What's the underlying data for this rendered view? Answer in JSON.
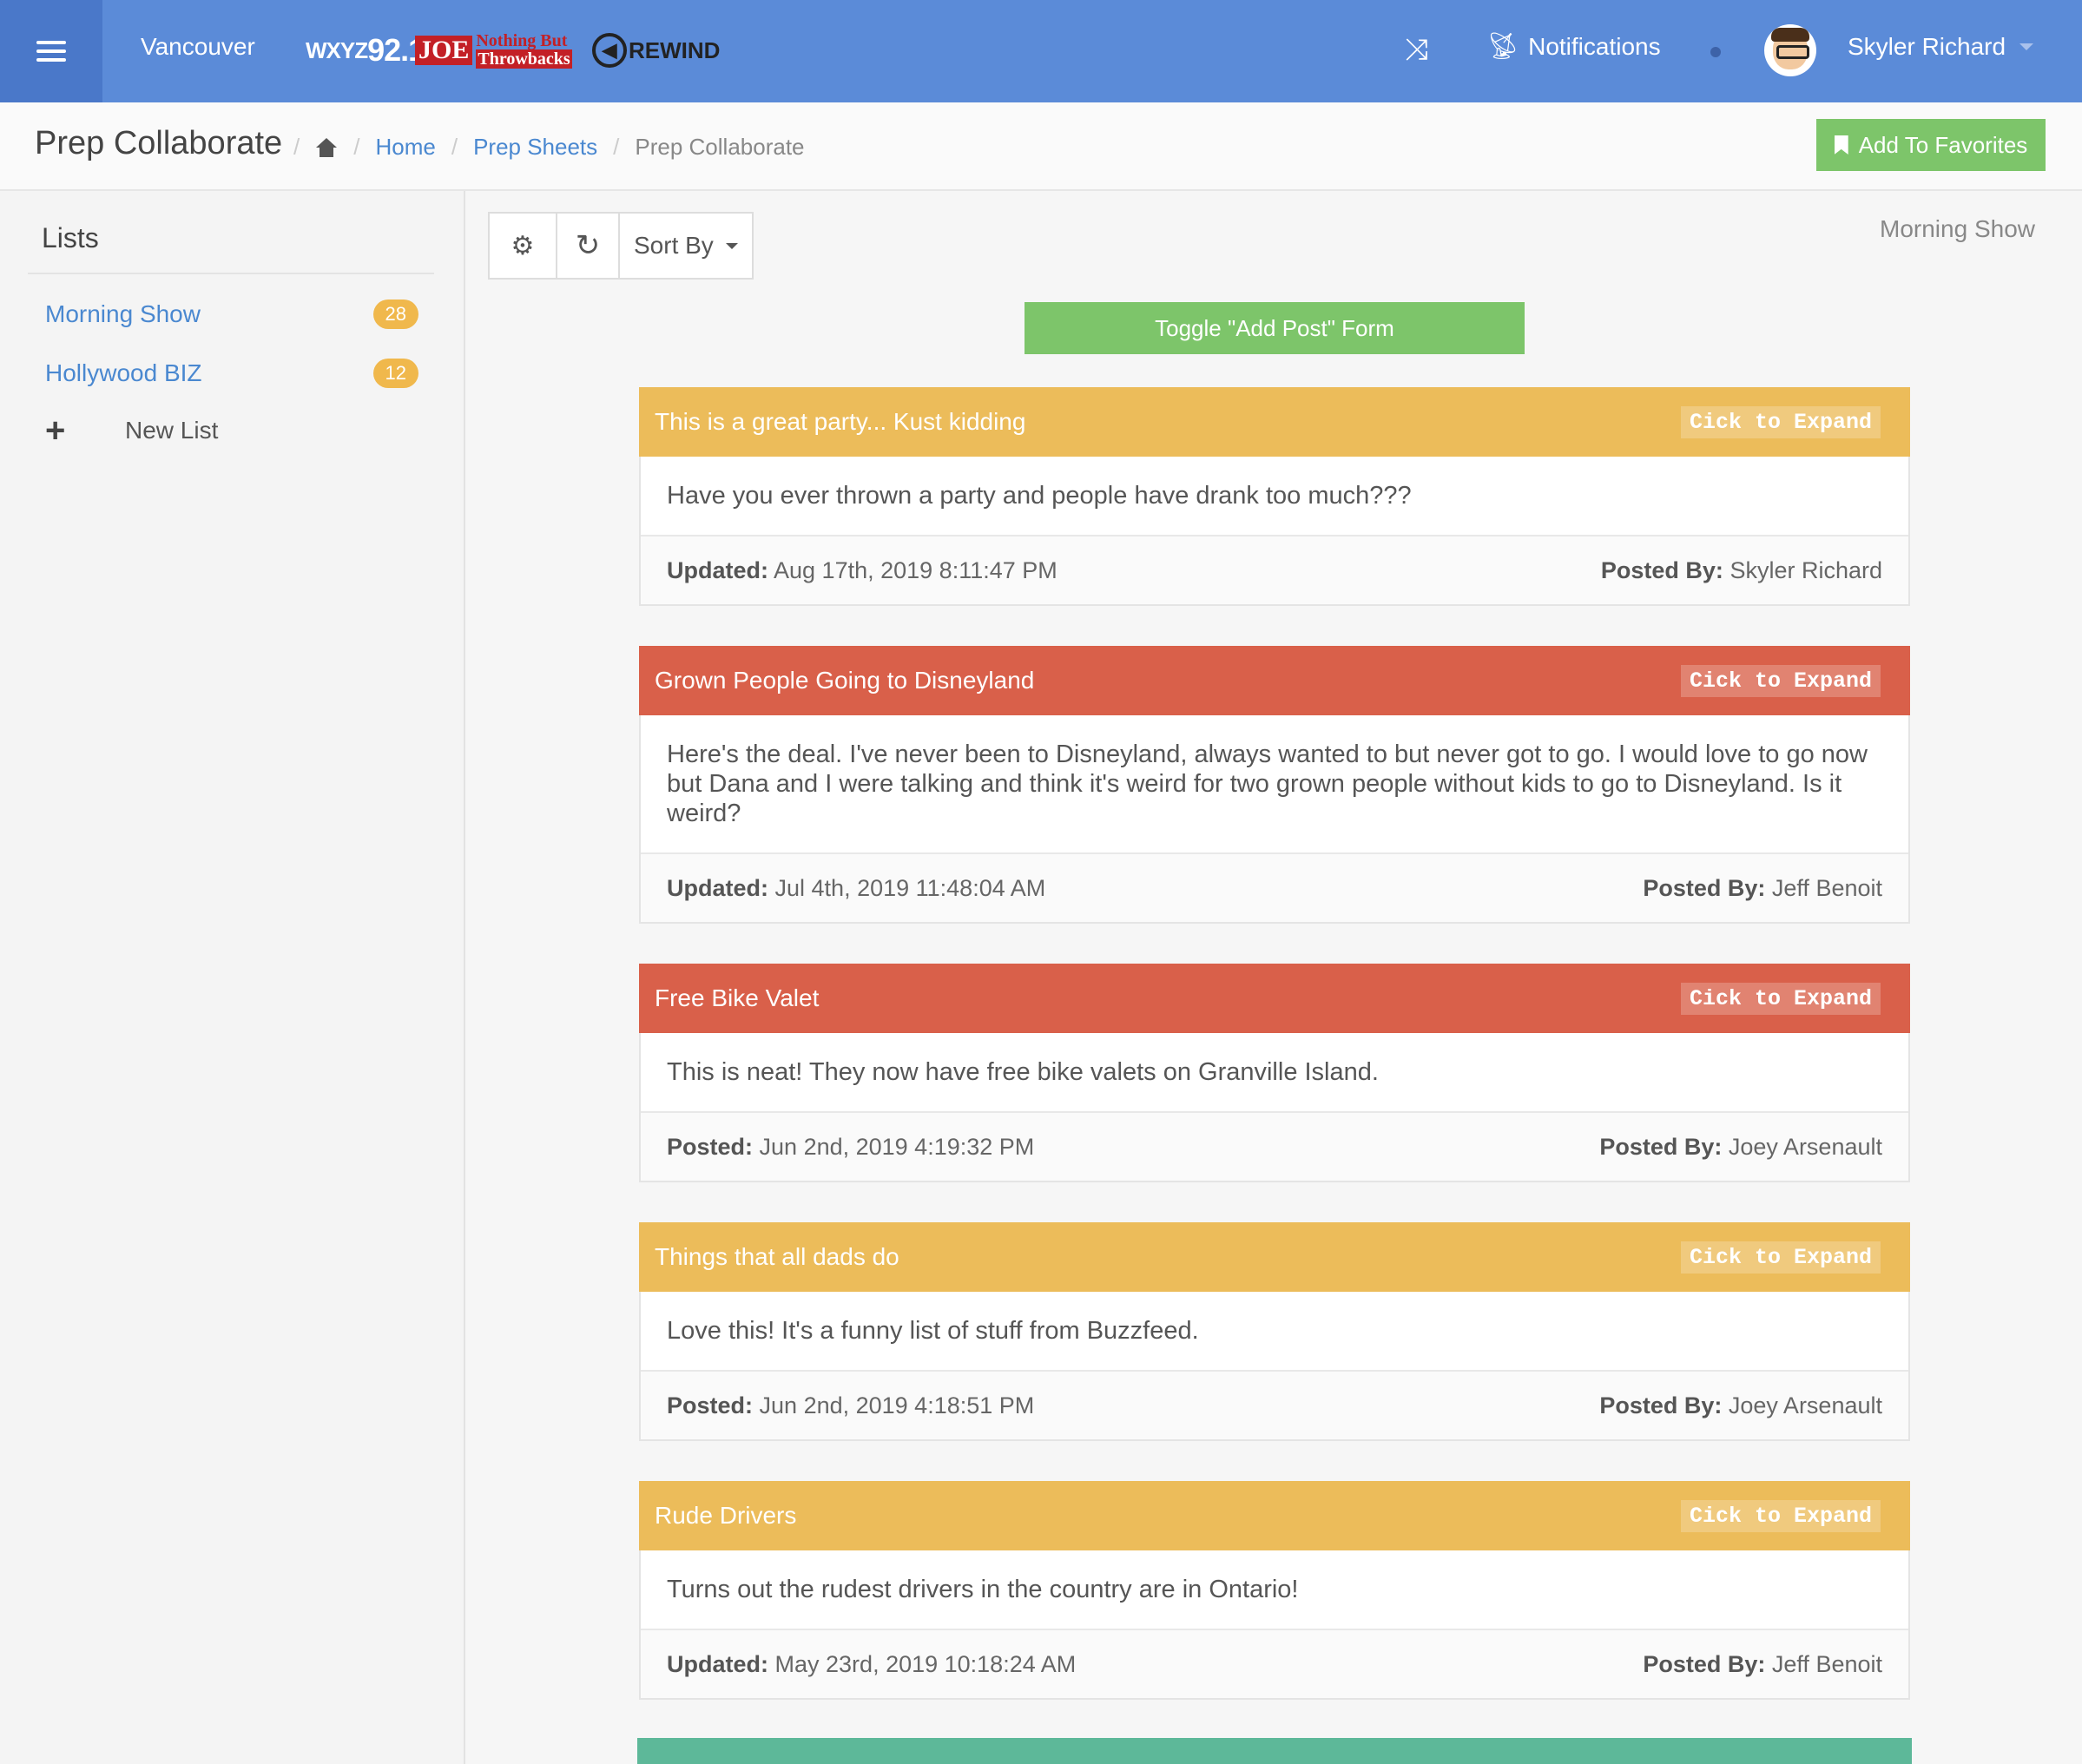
{
  "topbar": {
    "station": "Vancouver",
    "logos": {
      "wxyz_prefix": "WXYZ",
      "wxyz_freq": "92.1",
      "joe": "JOE",
      "joe_sub1": "Nothing But",
      "joe_sub2": "Throwbacks",
      "rewind": "REWIND"
    },
    "notifications_label": "Notifications",
    "user_name": "Skyler Richard"
  },
  "breadcrumb": {
    "page_title": "Prep Collaborate",
    "home": "Home",
    "prep_sheets": "Prep Sheets",
    "current": "Prep Collaborate",
    "sep": "/"
  },
  "favorites_label": "Add To Favorites",
  "sidebar": {
    "heading": "Lists",
    "items": [
      {
        "label": "Morning Show",
        "count": "28"
      },
      {
        "label": "Hollywood BIZ",
        "count": "12"
      }
    ],
    "new_list": "New List"
  },
  "toolbar": {
    "sort_label": "Sort By"
  },
  "list_name": "Morning Show",
  "toggle_label": "Toggle \"Add Post\" Form",
  "expand_label": "Cick to Expand",
  "posts": [
    {
      "title": "This is a great party... Kust kidding",
      "body": "Have you ever thrown a party and people have drank too much???",
      "date_label": "Updated:",
      "date": "Aug 17th, 2019 8:11:47 PM",
      "by_label": "Posted By:",
      "by": "Skyler Richard",
      "color": "#ecbc5a"
    },
    {
      "title": "Grown People Going to Disneyland",
      "body": "Here's the deal. I've never been to Disneyland, always wanted to but never got to go. I would love to go now but Dana and I were talking and think it's weird for two grown people without kids to go to Disneyland. Is it weird?",
      "date_label": "Updated:",
      "date": "Jul 4th, 2019 11:48:04 AM",
      "by_label": "Posted By:",
      "by": "Jeff Benoit",
      "color": "#d9604a"
    },
    {
      "title": "Free Bike Valet",
      "body": "This is neat! They now have free bike valets on Granville Island.",
      "date_label": "Posted:",
      "date": "Jun 2nd, 2019 4:19:32 PM",
      "by_label": "Posted By:",
      "by": "Joey Arsenault",
      "color": "#d9604a"
    },
    {
      "title": "Things that all dads do",
      "body": "Love this! It's a funny list of stuff from Buzzfeed.",
      "date_label": "Posted:",
      "date": "Jun 2nd, 2019 4:18:51 PM",
      "by_label": "Posted By:",
      "by": "Joey Arsenault",
      "color": "#ecbc5a"
    },
    {
      "title": "Rude Drivers",
      "body": "Turns out the rudest drivers in the country are in Ontario!",
      "date_label": "Updated:",
      "date": "May 23rd, 2019 10:18:24 AM",
      "by_label": "Posted By:",
      "by": "Jeff Benoit",
      "color": "#ecbc5a"
    }
  ],
  "colors": {
    "topbar": "#5b8bd8",
    "accent_green": "#7dc56a",
    "badge": "#f0b84c",
    "link": "#4a88d0"
  }
}
